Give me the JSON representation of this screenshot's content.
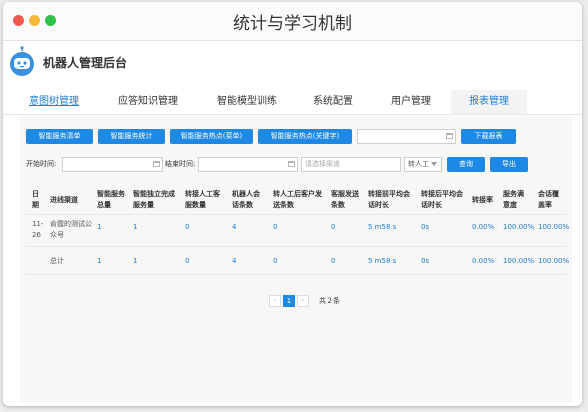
{
  "window": {
    "title": "统计与学习机制"
  },
  "colors": {
    "accent": "#1e88e5",
    "dot_close": "#f25a4f",
    "dot_min": "#f6b93b",
    "dot_max": "#2ec24a"
  },
  "brand": {
    "name": "机器人管理后台",
    "icon": "robot-icon"
  },
  "tabs": [
    {
      "label": "意图树管理"
    },
    {
      "label": "应答知识管理"
    },
    {
      "label": "智能模型训练"
    },
    {
      "label": "系统配置"
    },
    {
      "label": "用户管理"
    },
    {
      "label": "报表管理"
    }
  ],
  "toolbar": {
    "btn_list": "智能服务清单",
    "btn_stats": "智能服务统计",
    "btn_hot_menu": "智能服务热点(菜单)",
    "btn_hot_keyword": "智能服务热点(关键字)",
    "btn_download": "下载报表"
  },
  "filters": {
    "start_label": "开始时间:",
    "end_label": "结束时间:",
    "channel_placeholder": "请选择渠道",
    "transfer_select": "转人工",
    "query_button": "查询",
    "export_button": "导出"
  },
  "table": {
    "headers": [
      "日期",
      "进线渠道",
      "智能服务总量",
      "智能独立完成服务量",
      "转接人工客服数量",
      "机器人会话条数",
      "转人工后客户发送条数",
      "客服发送条数",
      "转接前平均会话时长",
      "转接后平均会话时长",
      "转接率",
      "服务满意度",
      "会话覆盖率"
    ],
    "rows": [
      [
        "11-26",
        "俞霞的测试公众号",
        "1",
        "1",
        "0",
        "4",
        "0",
        "0",
        "5 m58 s",
        "0s",
        "0.00%",
        "100.00%",
        "100.00%"
      ],
      [
        "",
        "总计",
        "1",
        "1",
        "0",
        "4",
        "0",
        "0",
        "5 m58 s",
        "0s",
        "0.00%",
        "100.00%",
        "100.00%"
      ]
    ]
  },
  "pagination": {
    "prev": "‹",
    "current": "1",
    "next": "›",
    "total_text": "共２条"
  }
}
